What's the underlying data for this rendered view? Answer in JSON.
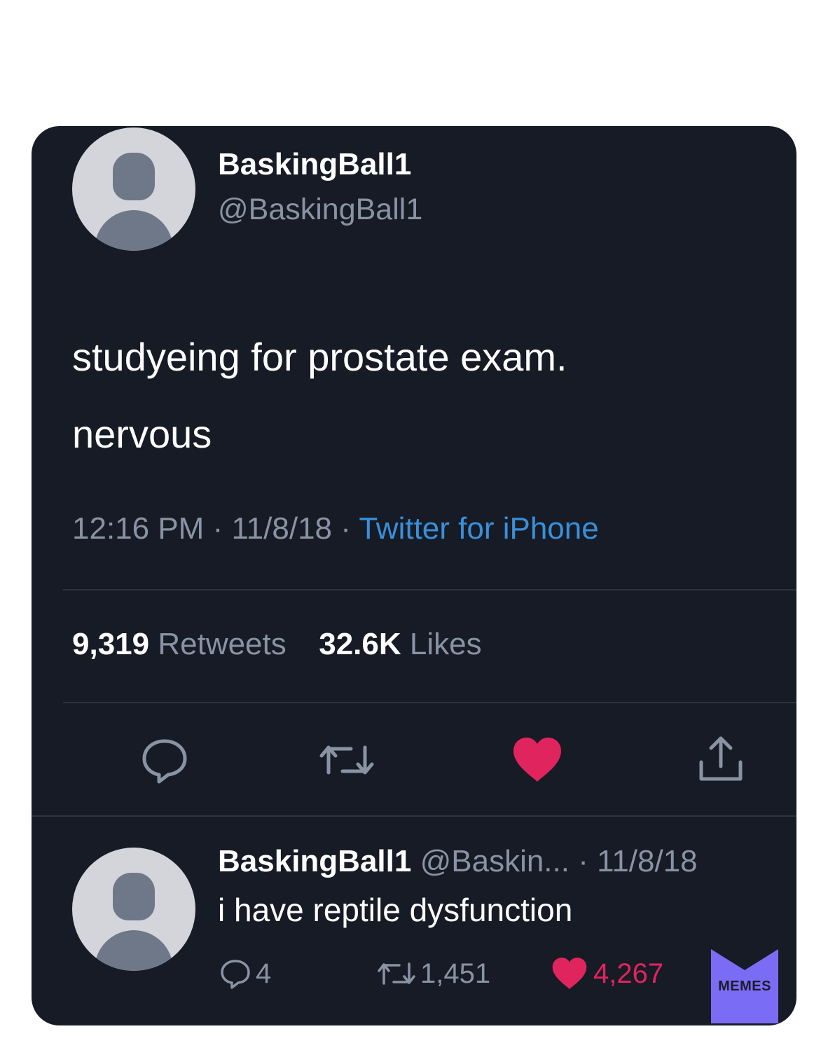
{
  "tweet": {
    "display_name": "BaskingBall1",
    "handle": "@BaskingBall1",
    "text_line1": "studyeing for prostate exam.",
    "text_line2": "nervous",
    "time": "12:16 PM",
    "date": "11/8/18",
    "source": "Twitter for iPhone",
    "retweet_count": "9,319",
    "retweet_label": "Retweets",
    "like_count": "32.6K",
    "like_label": "Likes",
    "liked": true
  },
  "reply": {
    "display_name": "BaskingBall1",
    "handle_truncated": "@Baskin...",
    "date": "11/8/18",
    "text": "i have reptile dysfunction",
    "reply_count": "4",
    "retweet_count": "1,451",
    "like_count": "4,267",
    "liked": true
  },
  "watermark": {
    "label": "MEMES",
    "color": "#7b6cf6"
  },
  "colors": {
    "background": "#161b25",
    "text_primary": "#ffffff",
    "text_secondary": "#8a93a3",
    "link": "#3a8fd9",
    "like": "#e0245e"
  },
  "icons": {
    "reply": "speech-bubble-icon",
    "retweet": "retweet-arrows-icon",
    "like": "heart-icon",
    "share": "share-upload-icon"
  }
}
